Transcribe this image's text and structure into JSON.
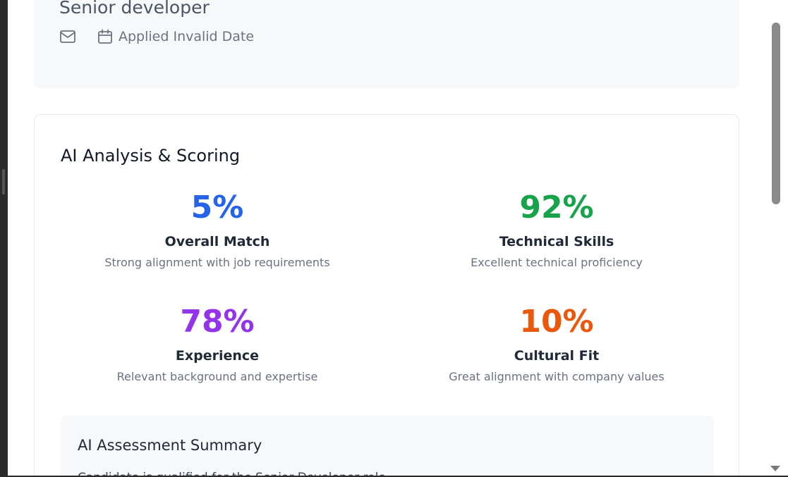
{
  "applicant": {
    "job_title": "Senior developer",
    "applied_text": "Applied Invalid Date"
  },
  "analysis": {
    "title": "AI Analysis & Scoring",
    "metrics": [
      {
        "percent": "5%",
        "label": "Overall Match",
        "description": "Strong alignment with job requirements",
        "color": "#2563eb"
      },
      {
        "percent": "92%",
        "label": "Technical Skills",
        "description": "Excellent technical proficiency",
        "color": "#16a34a"
      },
      {
        "percent": "78%",
        "label": "Experience",
        "description": "Relevant background and expertise",
        "color": "#9333ea"
      },
      {
        "percent": "10%",
        "label": "Cultural Fit",
        "description": "Great alignment with company values",
        "color": "#ea580c"
      }
    ],
    "summary": {
      "title": "AI Assessment Summary",
      "text": "Candidate is qualified for the Senior Developer role"
    }
  },
  "icons": {
    "email": "mail-icon",
    "calendar": "calendar-icon"
  }
}
